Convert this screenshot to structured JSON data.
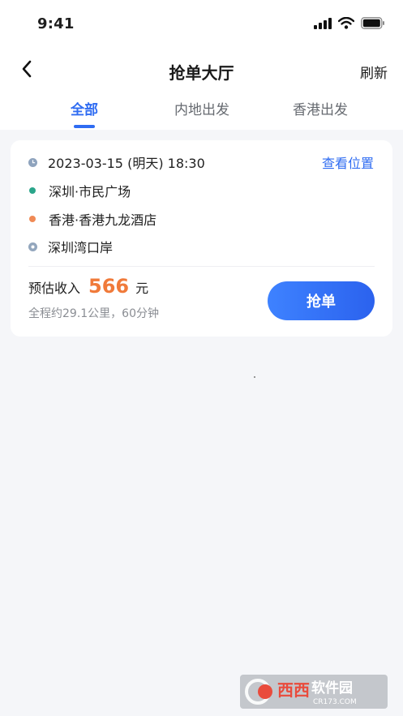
{
  "status_bar": {
    "time": "9:41"
  },
  "nav": {
    "title": "抢单大厅",
    "refresh_label": "刷新"
  },
  "tabs": [
    {
      "label": "全部",
      "active": true
    },
    {
      "label": "内地出发",
      "active": false
    },
    {
      "label": "香港出发",
      "active": false
    }
  ],
  "order": {
    "datetime": "2023-03-15 (明天) 18:30",
    "view_location": "查看位置",
    "start": "深圳·市民广场",
    "destination": "香港·香港九龙酒店",
    "checkpoint": "深圳湾口岸",
    "income_label": "预估收入",
    "income_amount": "566",
    "income_unit": "元",
    "trip_summary": "全程约29.1公里，60分钟",
    "grab_label": "抢单"
  },
  "watermark": {
    "text": "西西软件园",
    "sub": "CR173.COM"
  },
  "colors": {
    "accent": "#2f6cf2",
    "price": "#f07a3a",
    "start_dot": "#2aa58a",
    "dest_dot": "#f08a55",
    "clock_dot": "#8ea3bd",
    "checkpoint_dot": "#93a6bd"
  }
}
